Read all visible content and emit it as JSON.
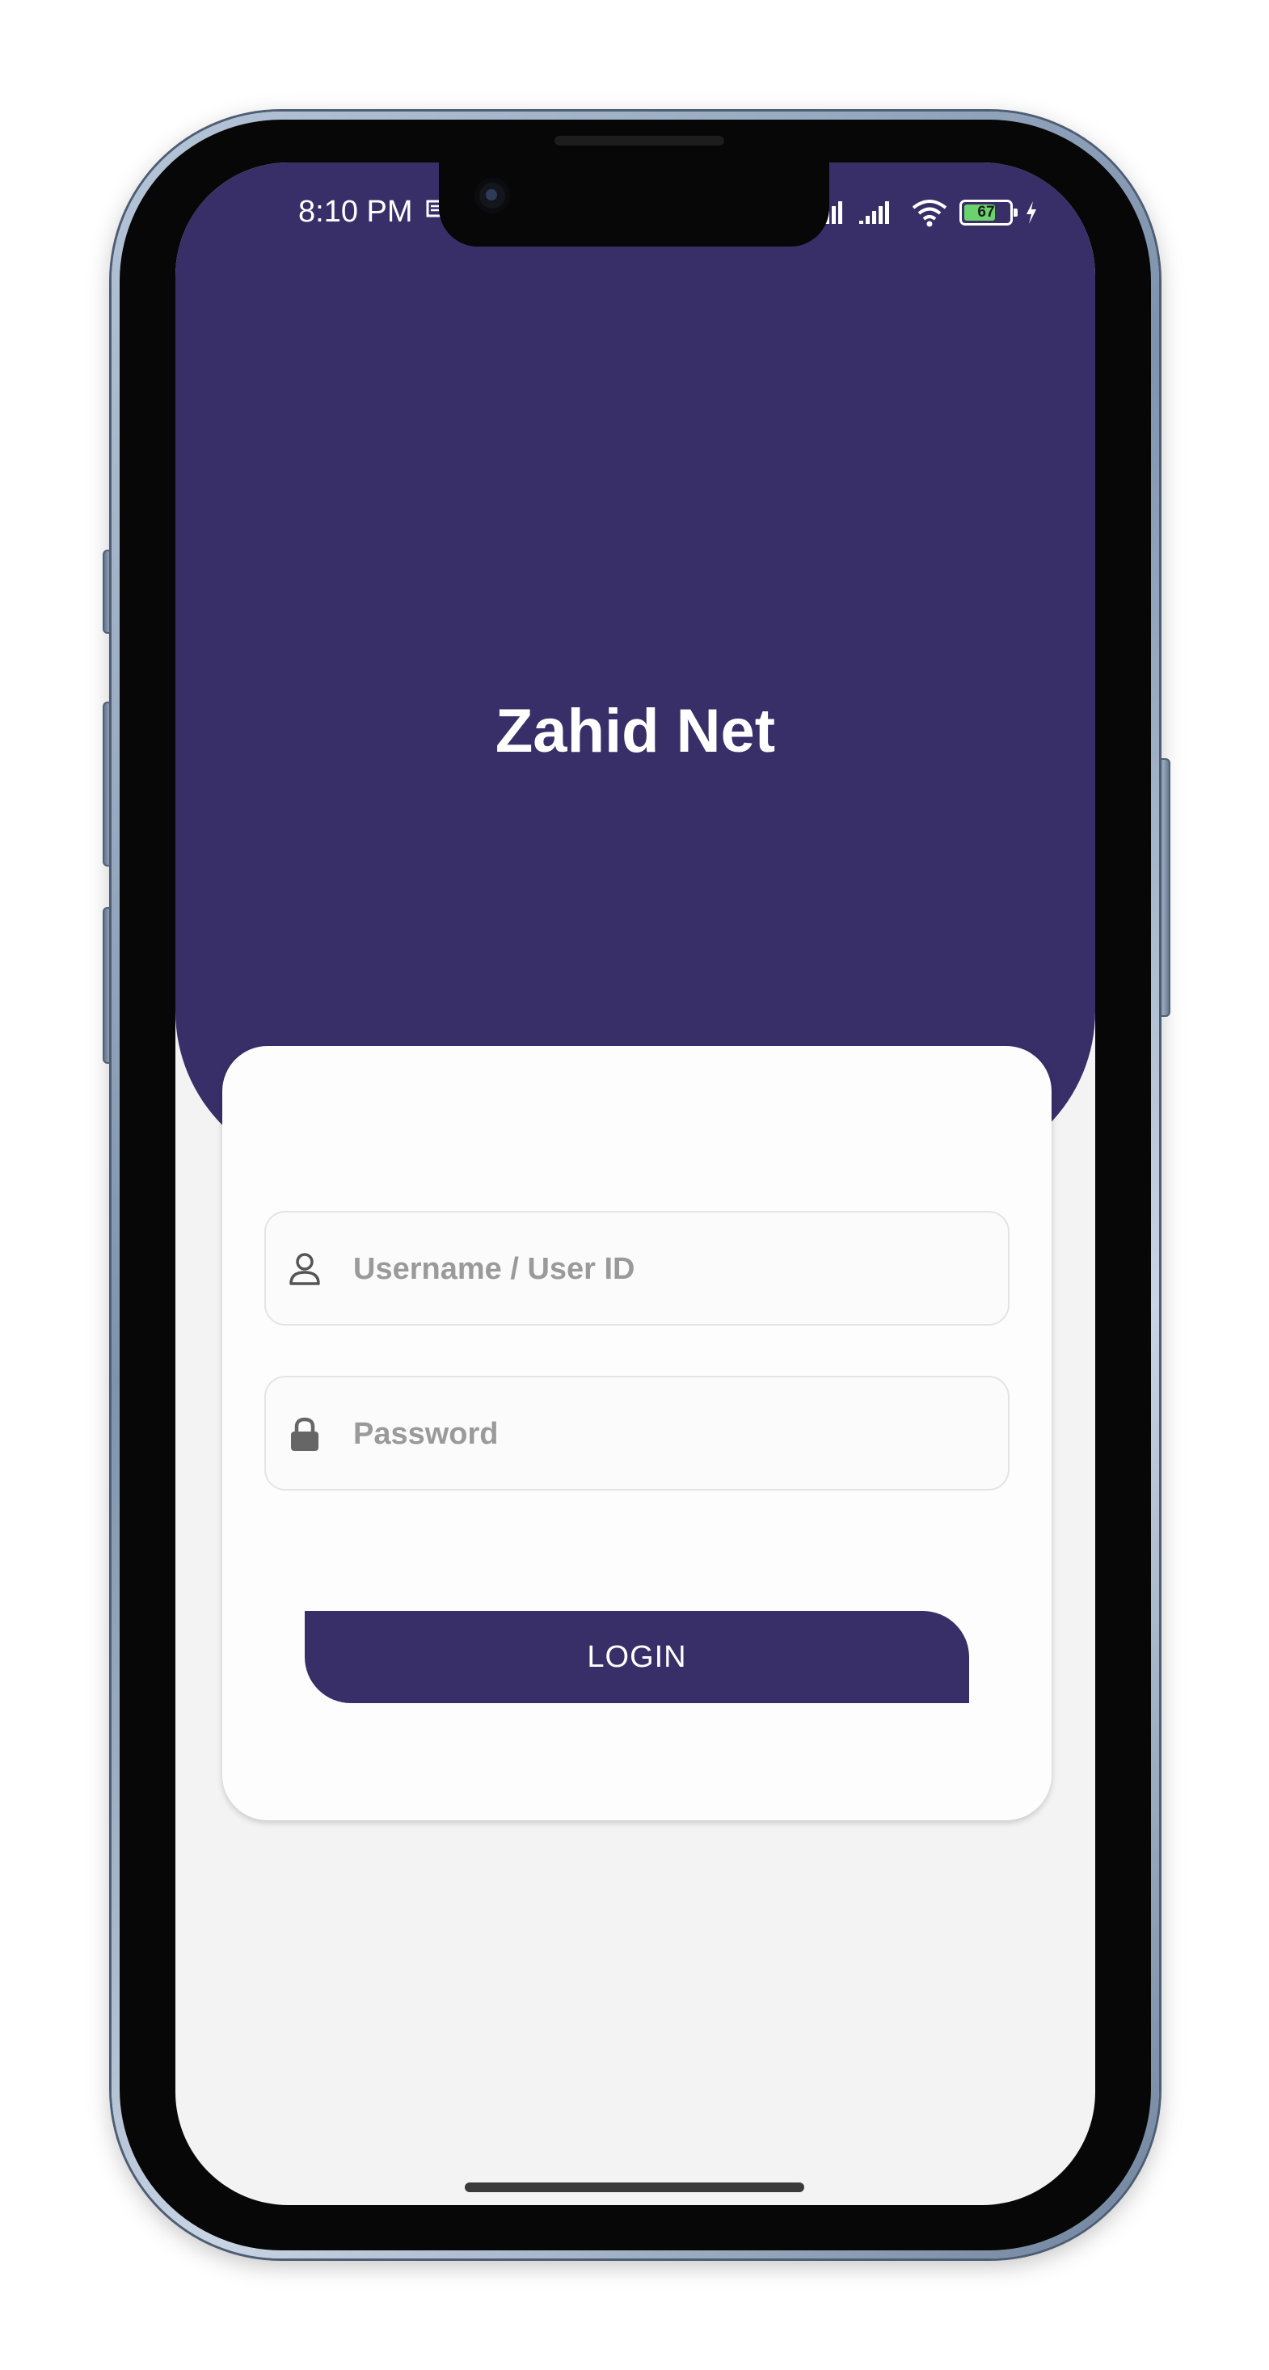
{
  "status_bar": {
    "time": "8:10 PM",
    "battery_level": "67",
    "icons": [
      "message-icon",
      "signal-icon",
      "signal-icon",
      "wifi-icon",
      "battery-icon",
      "charging-icon"
    ]
  },
  "app": {
    "title": "Zahid Net"
  },
  "login_form": {
    "username": {
      "placeholder": "Username / User ID",
      "value": "",
      "icon": "user-icon"
    },
    "password": {
      "placeholder": "Password",
      "value": "",
      "icon": "lock-icon"
    },
    "submit_label": "LOGIN"
  },
  "colors": {
    "brand": "#382f69",
    "background": "#f3f3f4",
    "card": "#fdfdfd",
    "placeholder": "#9a9a9a"
  }
}
